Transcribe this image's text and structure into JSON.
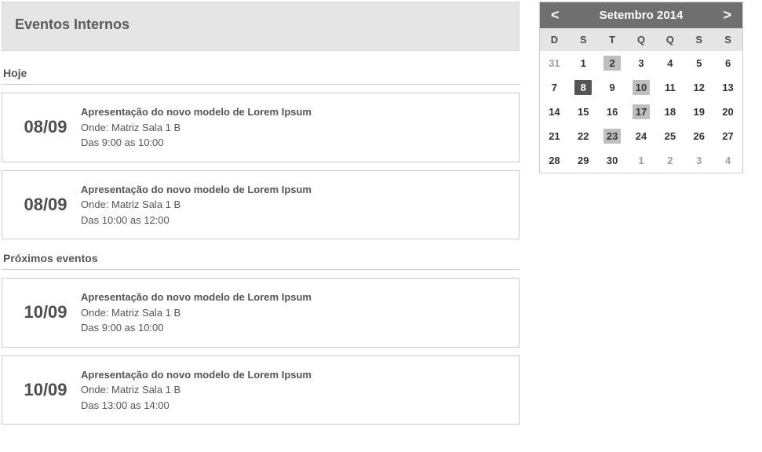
{
  "header": {
    "title": "Eventos Internos"
  },
  "sections": {
    "today_label": "Hoje",
    "upcoming_label": "Próximos eventos"
  },
  "events_today": [
    {
      "date": "08/09",
      "title": "Apresentação do novo modelo de Lorem Ipsum",
      "where": "Onde: Matriz Sala 1 B",
      "time": "Das 9:00 as 10:00"
    },
    {
      "date": "08/09",
      "title": "Apresentação do novo modelo de Lorem Ipsum",
      "where": "Onde: Matriz Sala 1 B",
      "time": "Das 10:00 as 12:00"
    }
  ],
  "events_upcoming": [
    {
      "date": "10/09",
      "title": "Apresentação do novo modelo de Lorem Ipsum",
      "where": "Onde: Matriz Sala 1 B",
      "time": "Das 9:00 as 10:00"
    },
    {
      "date": "10/09",
      "title": "Apresentação do novo modelo de Lorem Ipsum",
      "where": "Onde: Matriz Sala 1 B",
      "time": "Das 13:00 as 14:00"
    }
  ],
  "calendar": {
    "prev": "<",
    "next": ">",
    "title": "Setembro 2014",
    "dow": [
      "D",
      "S",
      "T",
      "Q",
      "Q",
      "S",
      "S"
    ],
    "selected_day": 8,
    "highlighted_days": [
      2,
      10,
      17,
      23
    ],
    "cells": [
      {
        "n": 31,
        "other": true
      },
      {
        "n": 1
      },
      {
        "n": 2
      },
      {
        "n": 3
      },
      {
        "n": 4
      },
      {
        "n": 5
      },
      {
        "n": 6
      },
      {
        "n": 7
      },
      {
        "n": 8
      },
      {
        "n": 9
      },
      {
        "n": 10
      },
      {
        "n": 11
      },
      {
        "n": 12
      },
      {
        "n": 13
      },
      {
        "n": 14
      },
      {
        "n": 15
      },
      {
        "n": 16
      },
      {
        "n": 17
      },
      {
        "n": 18
      },
      {
        "n": 19
      },
      {
        "n": 20
      },
      {
        "n": 21
      },
      {
        "n": 22
      },
      {
        "n": 23
      },
      {
        "n": 24
      },
      {
        "n": 25
      },
      {
        "n": 26
      },
      {
        "n": 27
      },
      {
        "n": 28
      },
      {
        "n": 29
      },
      {
        "n": 30
      },
      {
        "n": 1,
        "other": true
      },
      {
        "n": 2,
        "other": true
      },
      {
        "n": 3,
        "other": true
      },
      {
        "n": 4,
        "other": true
      }
    ]
  }
}
